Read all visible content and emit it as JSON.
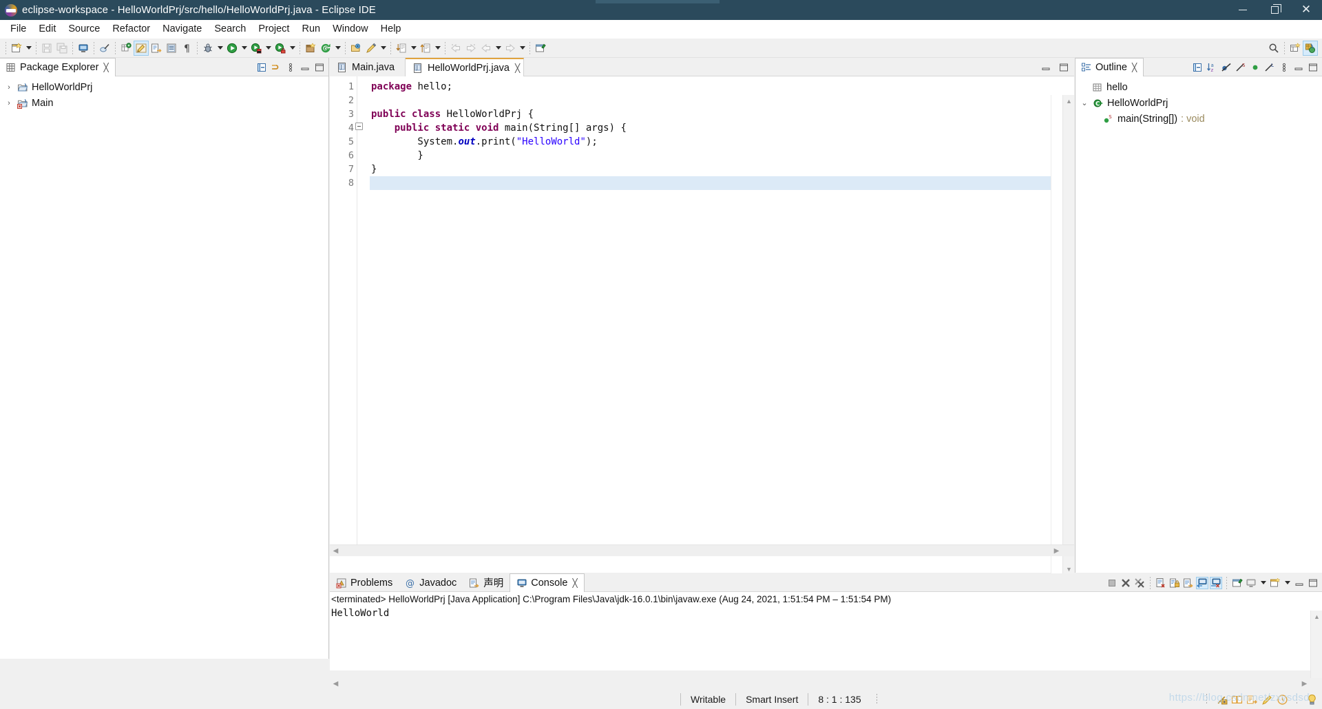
{
  "window": {
    "title": "eclipse-workspace - HelloWorldPrj/src/hello/HelloWorldPrj.java - Eclipse IDE",
    "app_icon": "eclipse-icon",
    "controls": {
      "minimize": "minimize-icon",
      "maximize": "maximize-icon",
      "close": "close-icon"
    }
  },
  "menubar": {
    "items": [
      {
        "label": "File"
      },
      {
        "label": "Edit"
      },
      {
        "label": "Source"
      },
      {
        "label": "Refactor"
      },
      {
        "label": "Navigate"
      },
      {
        "label": "Search"
      },
      {
        "label": "Project"
      },
      {
        "label": "Run"
      },
      {
        "label": "Window"
      },
      {
        "label": "Help"
      }
    ]
  },
  "toolbar": {
    "groups": [
      {
        "buttons": [
          {
            "name": "new-wizard-button",
            "icon": "new-file-icon",
            "dropdown": true,
            "enabled": true
          }
        ]
      },
      {
        "buttons": [
          {
            "name": "save-button",
            "icon": "save-icon",
            "dropdown": false,
            "enabled": false
          },
          {
            "name": "save-all-button",
            "icon": "save-all-icon",
            "dropdown": false,
            "enabled": false
          }
        ]
      },
      {
        "buttons": [
          {
            "name": "print-button",
            "icon": "print-icon",
            "dropdown": false,
            "enabled": true
          }
        ]
      },
      {
        "buttons": [
          {
            "name": "toggle-mark-occurrences-button",
            "icon": "mark-occurrences-icon",
            "dropdown": false,
            "enabled": true
          }
        ]
      },
      {
        "buttons": [
          {
            "name": "new-java-package-button",
            "icon": "new-package-icon",
            "dropdown": false,
            "enabled": true
          },
          {
            "name": "new-java-class-button",
            "icon": "new-class-icon",
            "dropdown": false,
            "enabled": true,
            "active": true
          },
          {
            "name": "open-type-button",
            "icon": "open-type-icon",
            "dropdown": false,
            "enabled": true
          },
          {
            "name": "open-task-button",
            "icon": "open-task-icon",
            "dropdown": false,
            "enabled": true
          },
          {
            "name": "toggle-whitespace-button",
            "icon": "pilcrow-icon",
            "dropdown": false,
            "enabled": true
          }
        ]
      },
      {
        "buttons": [
          {
            "name": "debug-button",
            "icon": "debug-bug-icon",
            "dropdown": true,
            "enabled": true
          },
          {
            "name": "run-button",
            "icon": "run-play-icon",
            "dropdown": true,
            "enabled": true
          },
          {
            "name": "coverage-button",
            "icon": "coverage-icon",
            "dropdown": true,
            "enabled": true
          },
          {
            "name": "external-tools-button",
            "icon": "external-tools-icon",
            "dropdown": true,
            "enabled": true
          }
        ]
      },
      {
        "buttons": [
          {
            "name": "new-project-button",
            "icon": "new-project-icon",
            "dropdown": false,
            "enabled": true
          },
          {
            "name": "refresh-button",
            "icon": "refresh-icon",
            "dropdown": true,
            "enabled": true
          }
        ]
      },
      {
        "buttons": [
          {
            "name": "open-resource-button",
            "icon": "open-folder-icon",
            "dropdown": false,
            "enabled": true
          },
          {
            "name": "quick-fix-button",
            "icon": "quick-fix-pen-icon",
            "dropdown": true,
            "enabled": true
          }
        ]
      },
      {
        "buttons": [
          {
            "name": "next-annotation-button",
            "icon": "next-annotation-icon",
            "dropdown": true,
            "enabled": true
          },
          {
            "name": "previous-annotation-button",
            "icon": "previous-annotation-icon",
            "dropdown": true,
            "enabled": true
          }
        ]
      },
      {
        "buttons": [
          {
            "name": "back-button",
            "icon": "back-arrow-icon",
            "dropdown": false,
            "enabled": false
          },
          {
            "name": "forward-button",
            "icon": "forward-arrow-icon",
            "dropdown": false,
            "enabled": false
          },
          {
            "name": "previous-edit-button",
            "icon": "left-arrow-icon",
            "dropdown": true,
            "enabled": false
          },
          {
            "name": "next-edit-button",
            "icon": "right-arrow-icon",
            "dropdown": true,
            "enabled": false
          }
        ]
      },
      {
        "buttons": [
          {
            "name": "pin-editor-button",
            "icon": "pin-editor-icon",
            "dropdown": false,
            "enabled": true
          }
        ]
      }
    ],
    "right": [
      {
        "name": "quick-access-search-button",
        "icon": "search-icon"
      },
      {
        "name": "open-perspective-button",
        "icon": "open-perspective-icon"
      },
      {
        "name": "java-perspective-button",
        "icon": "java-perspective-icon",
        "active": true
      }
    ]
  },
  "package_explorer": {
    "title": "Package Explorer",
    "title_icon": "package-explorer-icon",
    "close_icon": "close-icon",
    "tools": [
      {
        "name": "collapse-all-button",
        "icon": "collapse-all-icon"
      },
      {
        "name": "link-with-editor-button",
        "icon": "link-editor-icon"
      },
      {
        "name": "view-menu-button",
        "icon": "view-menu-icon"
      },
      {
        "name": "minimize-view-button",
        "icon": "minimize-view-icon"
      },
      {
        "name": "maximize-view-button",
        "icon": "maximize-view-icon"
      }
    ],
    "items": [
      {
        "label": "HelloWorldPrj",
        "icon": "java-project-icon",
        "expanded": false,
        "twisty": "›"
      },
      {
        "label": "Main",
        "icon": "java-project-error-icon",
        "expanded": false,
        "twisty": "›"
      }
    ]
  },
  "editor": {
    "tabs": [
      {
        "label": "Main.java",
        "icon": "java-file-icon",
        "active": false,
        "closeable": false
      },
      {
        "label": "HelloWorldPrj.java",
        "icon": "java-file-icon",
        "active": true,
        "closeable": true,
        "close_icon": "close-icon"
      }
    ],
    "tools": [
      {
        "name": "minimize-editor-button",
        "icon": "minimize-view-icon"
      },
      {
        "name": "maximize-editor-button",
        "icon": "maximize-view-icon"
      }
    ],
    "current_line": 8,
    "lines": [
      {
        "num": 1,
        "fold": false,
        "tokens": [
          {
            "t": "package",
            "c": "kw"
          },
          {
            "t": " hello;",
            "c": ""
          }
        ]
      },
      {
        "num": 2,
        "fold": false,
        "tokens": [
          {
            "t": "",
            "c": ""
          }
        ]
      },
      {
        "num": 3,
        "fold": false,
        "tokens": [
          {
            "t": "public class",
            "c": "kw"
          },
          {
            "t": " HelloWorldPrj {",
            "c": ""
          }
        ]
      },
      {
        "num": 4,
        "fold": true,
        "tokens": [
          {
            "t": "    ",
            "c": ""
          },
          {
            "t": "public static void",
            "c": "kw"
          },
          {
            "t": " main(String[] args) {",
            "c": ""
          }
        ]
      },
      {
        "num": 5,
        "fold": false,
        "tokens": [
          {
            "t": "        System.",
            "c": ""
          },
          {
            "t": "out",
            "c": "stat"
          },
          {
            "t": ".print(",
            "c": ""
          },
          {
            "t": "\"HelloWorld\"",
            "c": "str"
          },
          {
            "t": ");",
            "c": ""
          }
        ]
      },
      {
        "num": 6,
        "fold": false,
        "tokens": [
          {
            "t": "        }",
            "c": ""
          }
        ]
      },
      {
        "num": 7,
        "fold": false,
        "tokens": [
          {
            "t": "}",
            "c": ""
          }
        ]
      },
      {
        "num": 8,
        "fold": false,
        "tokens": [
          {
            "t": "",
            "c": ""
          }
        ]
      }
    ],
    "scroll": {
      "up_icon": "scroll-up-icon",
      "down_icon": "scroll-down-icon",
      "left_icon": "scroll-left-icon",
      "right_icon": "scroll-right-icon"
    }
  },
  "outline": {
    "title": "Outline",
    "title_icon": "outline-icon",
    "close_icon": "close-icon",
    "tools": [
      {
        "name": "collapse-all-button",
        "icon": "collapse-all-icon"
      },
      {
        "name": "sort-button",
        "icon": "sort-az-icon"
      },
      {
        "name": "hide-fields-button",
        "icon": "hide-fields-icon"
      },
      {
        "name": "hide-static-button",
        "icon": "hide-static-icon"
      },
      {
        "name": "hide-non-public-button",
        "icon": "hide-nonpublic-icon"
      },
      {
        "name": "hide-local-types-button",
        "icon": "hide-local-types-icon"
      },
      {
        "name": "view-menu-button",
        "icon": "view-menu-icon"
      },
      {
        "name": "minimize-view-button",
        "icon": "minimize-view-icon"
      },
      {
        "name": "maximize-view-button",
        "icon": "maximize-view-icon"
      }
    ],
    "items": [
      {
        "label": "hello",
        "icon": "package-icon",
        "indent": 1,
        "twisty": "",
        "suffix": ""
      },
      {
        "label": "HelloWorldPrj",
        "icon": "class-icon",
        "indent": 0,
        "twisty": "⌄",
        "suffix": ""
      },
      {
        "label": "main(String[])",
        "icon": "method-public-static-icon",
        "indent": 2,
        "twisty": "",
        "suffix": " : void"
      }
    ]
  },
  "console_panel": {
    "tabs": [
      {
        "label": "Problems",
        "icon": "problems-icon",
        "active": false
      },
      {
        "label": "Javadoc",
        "icon": "javadoc-icon",
        "active": false
      },
      {
        "label": "声明",
        "icon": "declaration-icon",
        "active": false
      },
      {
        "label": "Console",
        "icon": "console-icon",
        "active": true,
        "close_icon": "close-icon"
      }
    ],
    "tools": [
      {
        "name": "terminate-button",
        "icon": "terminate-icon"
      },
      {
        "name": "remove-launch-button",
        "icon": "remove-launch-icon"
      },
      {
        "name": "remove-all-terminated-button",
        "icon": "remove-all-icon"
      },
      {
        "name": "clear-console-button",
        "icon": "clear-console-icon"
      },
      {
        "name": "scroll-lock-button",
        "icon": "scroll-lock-icon"
      },
      {
        "name": "word-wrap-button",
        "icon": "word-wrap-icon"
      },
      {
        "name": "show-console-on-output-button",
        "icon": "show-on-output-icon",
        "active": true
      },
      {
        "name": "show-console-on-error-button",
        "icon": "show-on-error-icon",
        "active": true
      },
      {
        "name": "pin-console-button",
        "icon": "pin-console-icon"
      },
      {
        "name": "display-selected-console-button",
        "icon": "display-console-icon",
        "dropdown": true
      },
      {
        "name": "open-console-button",
        "icon": "open-console-icon",
        "dropdown": true
      },
      {
        "name": "minimize-view-button",
        "icon": "minimize-view-icon"
      },
      {
        "name": "maximize-view-button",
        "icon": "maximize-view-icon"
      }
    ],
    "header_line": "<terminated> HelloWorldPrj [Java Application] C:\\Program Files\\Java\\jdk-16.0.1\\bin\\javaw.exe  (Aug 24, 2021, 1:51:54 PM – 1:51:54 PM)",
    "output": "HelloWorld"
  },
  "statusbar": {
    "writable": "Writable",
    "insert_mode": "Smart Insert",
    "position": "8 : 1 : 135",
    "right_tools": [
      {
        "name": "build-status-icon",
        "icon": "build-icon"
      },
      {
        "name": "open-book-icon",
        "icon": "book-icon"
      },
      {
        "name": "tasks-icon",
        "icon": "tasks-icon"
      },
      {
        "name": "highlight-icon",
        "icon": "pen-icon"
      },
      {
        "name": "clock-icon",
        "icon": "clock-icon"
      },
      {
        "name": "tip-of-day-icon",
        "icon": "lightbulb-icon"
      }
    ]
  },
  "watermark": "https://blog.csdn.net/zxysdsd"
}
